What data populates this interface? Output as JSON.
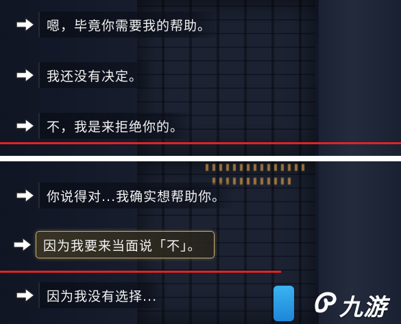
{
  "top_options": [
    {
      "text": "嗯，毕竟你需要我的帮助。"
    },
    {
      "text": "我还没有决定。"
    },
    {
      "text": "不，我是来拒绝你的。"
    }
  ],
  "bottom_options": [
    {
      "text": "你说得对...我确实想帮助你。"
    },
    {
      "text": "因为我要来当面说「不」。",
      "selected": true
    },
    {
      "text": "因为我没有选择..."
    }
  ],
  "watermark": {
    "text": "九游"
  },
  "colors": {
    "highlight_line": "#e52222",
    "selected_border": "#c8ae6a",
    "logo_blue": "#2a9be6"
  }
}
